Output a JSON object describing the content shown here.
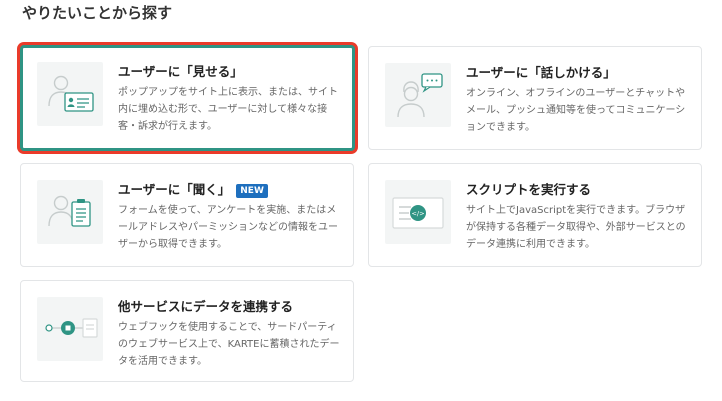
{
  "page": {
    "title": "やりたいことから探す"
  },
  "cards": [
    {
      "title": "ユーザーに「見せる」",
      "description": "ポップアップをサイト上に表示、または、サイト内に埋め込む形で、ユーザーに対して様々な接客・訴求が行えます。",
      "icon": "person-with-id-card-icon",
      "selected": true
    },
    {
      "title": "ユーザーに「話しかける」",
      "description": "オンライン、オフラインのユーザーとチャットやメール、プッシュ通知等を使ってコミュニケーションできます。",
      "icon": "person-with-speech-bubble-icon"
    },
    {
      "title": "ユーザーに「聞く」",
      "badge": "NEW",
      "description": "フォームを使って、アンケートを実施、またはメールアドレスやパーミッションなどの情報をユーザーから取得できます。",
      "icon": "person-with-form-icon"
    },
    {
      "title": "スクリプトを実行する",
      "description": "サイト上でJavaScriptを実行できます。ブラウザが保持する各種データ取得や、外部サービスとのデータ連携に利用できます。",
      "icon": "script-code-icon"
    },
    {
      "title": "他サービスにデータを連携する",
      "description": "ウェブフックを使用することで、サードパーティのウェブサービス上で、KARTEに蓄積されたデータを活用できます。",
      "icon": "data-link-icon"
    }
  ],
  "colors": {
    "accent": "#2f9484",
    "highlight": "#ea3b2a",
    "badge": "#1e6fbe"
  }
}
